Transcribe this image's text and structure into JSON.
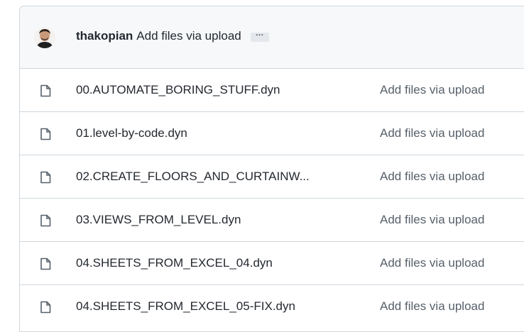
{
  "commit": {
    "author": "thakopian",
    "message": "Add files via upload",
    "more_label": "…"
  },
  "files": [
    {
      "name": "00.AUTOMATE_BORING_STUFF.dyn",
      "message": "Add files via upload",
      "icon": "file-icon"
    },
    {
      "name": "01.level-by-code.dyn",
      "message": "Add files via upload",
      "icon": "file-icon"
    },
    {
      "name": "02.CREATE_FLOORS_AND_CURTAINW...",
      "message": "Add files via upload",
      "icon": "file-icon"
    },
    {
      "name": "03.VIEWS_FROM_LEVEL.dyn",
      "message": "Add files via upload",
      "icon": "file-icon"
    },
    {
      "name": "04.SHEETS_FROM_EXCEL_04.dyn",
      "message": "Add files via upload",
      "icon": "file-icon"
    },
    {
      "name": "04.SHEETS_FROM_EXCEL_05-FIX.dyn",
      "message": "Add files via upload",
      "icon": "file-icon"
    }
  ]
}
